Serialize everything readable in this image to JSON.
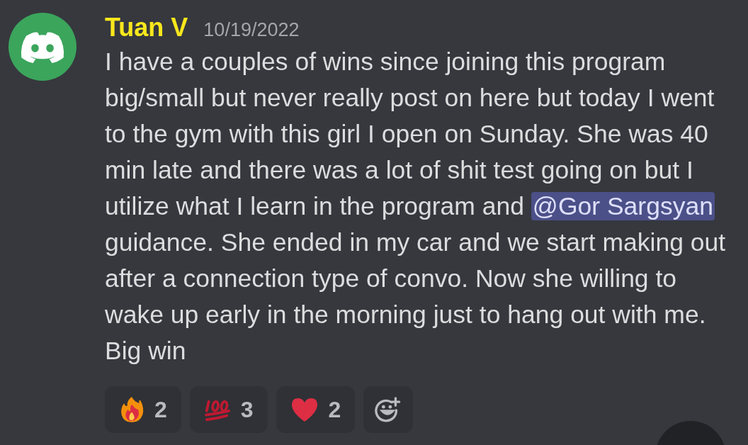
{
  "message": {
    "author": "Tuan V",
    "timestamp": "10/19/2022",
    "body": [
      {
        "kind": "text",
        "text": "I have a couples of wins since joining this program big/small but never really post on here but today I went to the gym with this girl I open on Sunday. She was 40 min late and there was a lot of shit test going on but I utilize what I learn in the program and "
      },
      {
        "kind": "mention",
        "text": "@Gor Sargsyan"
      },
      {
        "kind": "text",
        "text": " guidance. She ended in my car and we start making out after a connection type of convo. Now she willing to wake up early in the morning just to hang out with me. Big win"
      }
    ],
    "reactions": [
      {
        "kind": "fire",
        "count": "2"
      },
      {
        "kind": "hundred",
        "count": "3"
      },
      {
        "kind": "heart",
        "count": "2"
      }
    ]
  }
}
